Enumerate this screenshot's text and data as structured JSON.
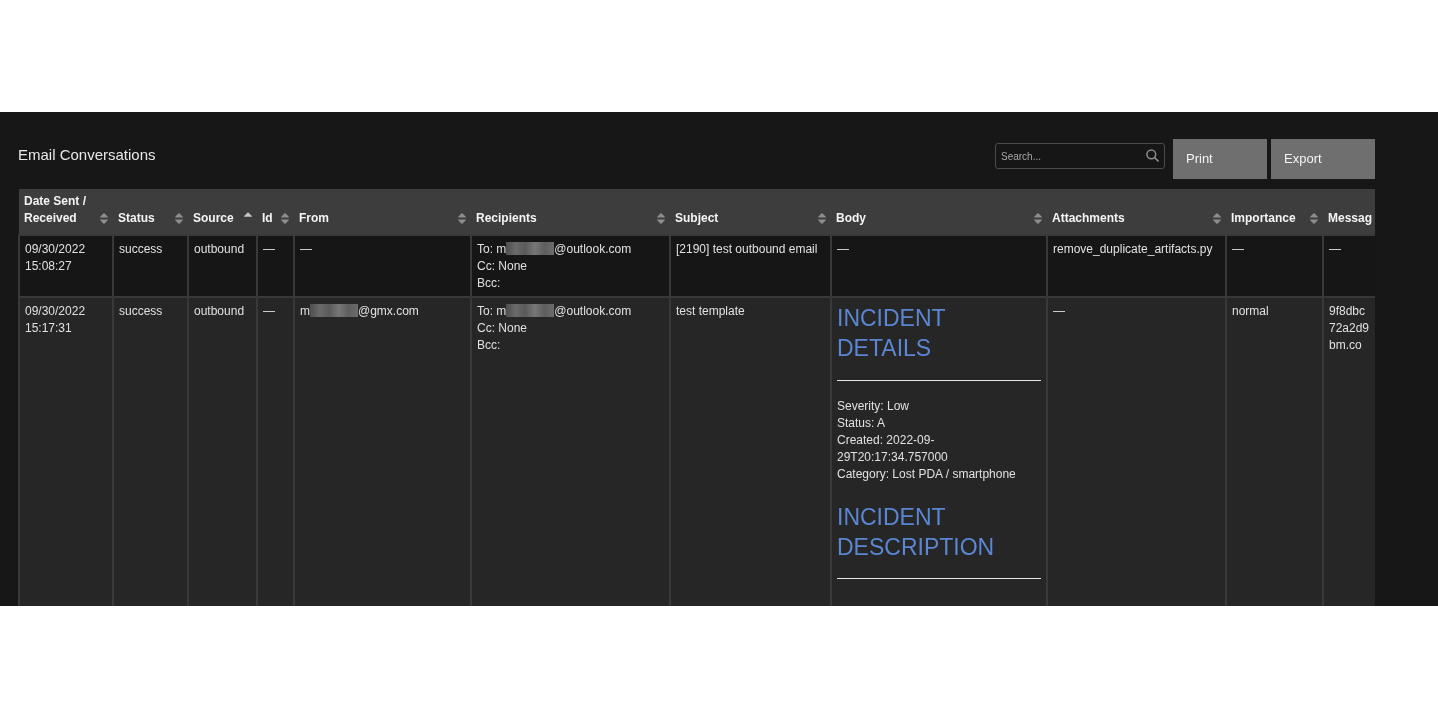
{
  "panel": {
    "title": "Email Conversations"
  },
  "toolbar": {
    "search": {
      "placeholder": "Search..."
    },
    "buttons": [
      "Print",
      "Export"
    ]
  },
  "table": {
    "columns": [
      {
        "label": "Date Sent / Received",
        "sorted": false
      },
      {
        "label": "Status",
        "sorted": false
      },
      {
        "label": "Source",
        "sorted": true
      },
      {
        "label": "Id",
        "sorted": false
      },
      {
        "label": "From",
        "sorted": false
      },
      {
        "label": "Recipients",
        "sorted": false
      },
      {
        "label": "Subject",
        "sorted": false
      },
      {
        "label": "Body",
        "sorted": false
      },
      {
        "label": "Attachments",
        "sorted": false
      },
      {
        "label": "Importance",
        "sorted": false
      },
      {
        "label": "Messag"
      }
    ],
    "rows": [
      {
        "cells": [
          {
            "kind": "text",
            "text": "09/30/2022 15:08:27"
          },
          {
            "kind": "text",
            "text": "success"
          },
          {
            "kind": "text",
            "text": "outbound"
          },
          {
            "kind": "text",
            "text": "—"
          },
          {
            "kind": "text",
            "text": "—"
          },
          {
            "kind": "recipients",
            "to": {
              "prefix": "To: m",
              "suffix": "@outlook.com"
            },
            "cc": "Cc: None",
            "bcc": "Bcc:"
          },
          {
            "kind": "text",
            "text": "[2190] test outbound email"
          },
          {
            "kind": "text",
            "text": "—"
          },
          {
            "kind": "text",
            "text": "remove_duplicate_artifacts.py"
          },
          {
            "kind": "text",
            "text": "—"
          },
          {
            "kind": "text",
            "text": "—"
          }
        ]
      },
      {
        "cells": [
          {
            "kind": "text",
            "text": "09/30/2022 15:17:31"
          },
          {
            "kind": "text",
            "text": "success"
          },
          {
            "kind": "text",
            "text": "outbound"
          },
          {
            "kind": "text",
            "text": "—"
          },
          {
            "kind": "email",
            "prefix": "m",
            "suffix": "@gmx.com"
          },
          {
            "kind": "recipients",
            "to": {
              "prefix": "To: m",
              "suffix": "@outlook.com"
            },
            "cc": "Cc: None",
            "bcc": "Bcc:"
          },
          {
            "kind": "text",
            "text": "test template"
          },
          {
            "kind": "body",
            "blocks": [
              {
                "kind": "heading",
                "text": "INCIDENT DETAILS"
              },
              {
                "kind": "rule"
              },
              {
                "kind": "lines",
                "lines": [
                  "Severity: Low",
                  "Status: A",
                  "Created: 2022-09-29T20:17:34.757000",
                  "Category: Lost PDA / smartphone"
                ]
              },
              {
                "kind": "heading",
                "text": "INCIDENT DESCRIPTION"
              },
              {
                "kind": "rule"
              }
            ]
          },
          {
            "kind": "text",
            "text": "—"
          },
          {
            "kind": "text",
            "text": "normal"
          },
          {
            "kind": "lines",
            "lines": [
              "9f8dbc",
              "72a2d9",
              "bm.co"
            ]
          }
        ]
      }
    ]
  }
}
